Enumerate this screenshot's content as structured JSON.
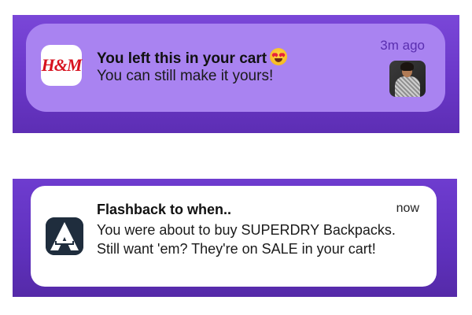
{
  "notifications": [
    {
      "app_icon": "hm-logo",
      "app_icon_text": "H&M",
      "title": "You left this in your cart",
      "title_emoji": "heart-eyes-emoji",
      "body": "You can still make it yours!",
      "time": "3m ago",
      "thumbnail": "product-photo-woman-knit-top",
      "background_color": "#a983f1"
    },
    {
      "app_icon": "ajio-a-logo",
      "title": "Flashback to when..",
      "body": "You were about to buy SUPERDRY Backpacks. Still want 'em? They're on SALE in your cart!",
      "time": "now",
      "background_color": "#ffffff"
    }
  ],
  "colors": {
    "band_purple": "#6a37c8",
    "hm_red": "#d7121f",
    "dark_icon_bg": "#1f2d3d"
  }
}
